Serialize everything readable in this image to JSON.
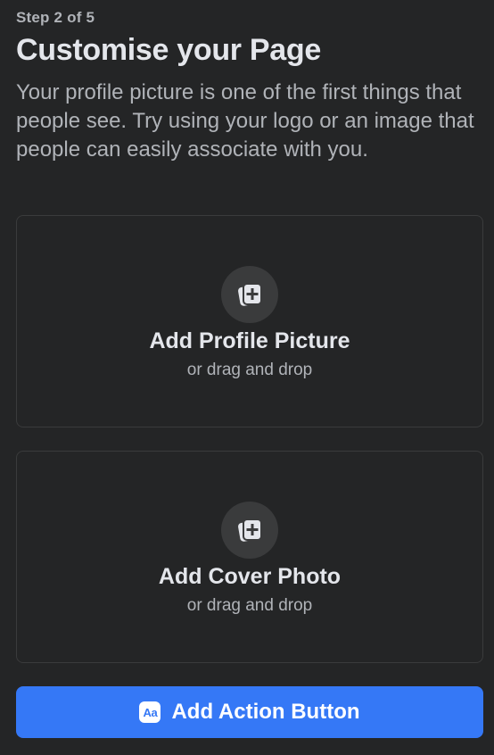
{
  "header": {
    "step": "Step 2 of 5",
    "title": "Customise your Page",
    "description": "Your profile picture is one of the first things that people see. Try using your logo or an image that people can easily associate with you."
  },
  "profile_picture": {
    "label": "Add Profile Picture",
    "hint": "or drag and drop",
    "icon": "add-photo-icon"
  },
  "cover_photo": {
    "label": "Add Cover Photo",
    "hint": "or drag and drop",
    "icon": "add-photo-icon"
  },
  "action_button": {
    "icon_text": "Aa",
    "label": "Add Action Button",
    "color": "#3578f6"
  },
  "colors": {
    "background": "#242526",
    "card_border": "#3a3b3c",
    "primary_text": "#e4e6eb",
    "secondary_text": "#b0b3b8",
    "accent": "#3578f6"
  }
}
